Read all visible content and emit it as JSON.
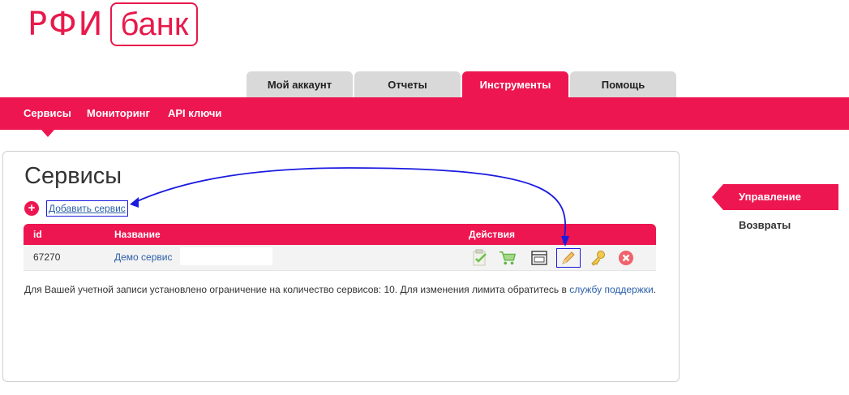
{
  "logo": {
    "left": "РФИ",
    "right": "банк"
  },
  "tabs": [
    {
      "label": "Мой аккаунт",
      "active": false
    },
    {
      "label": "Отчеты",
      "active": false
    },
    {
      "label": "Инструменты",
      "active": true
    },
    {
      "label": "Помощь",
      "active": false
    }
  ],
  "subnav": {
    "items": [
      "Сервисы",
      "Мониторинг",
      "API ключи"
    ],
    "active": "Сервисы"
  },
  "page": {
    "title": "Сервисы",
    "add_service": "Добавить сервис",
    "table": {
      "headers": {
        "id": "id",
        "name": "Название",
        "actions": "Действия"
      },
      "rows": [
        {
          "id": "67270",
          "name": "Демо сервис"
        }
      ],
      "action_icons": [
        "clipboard-check-icon",
        "cart-icon",
        "window-icon",
        "pencil-icon",
        "key-icon",
        "delete-icon"
      ]
    },
    "note": {
      "text": "Для Вашей учетной записи установлено ограничение на количество сервисов: 10. Для изменения лимита обратитесь в ",
      "link": "службу поддержки",
      "end": "."
    }
  },
  "sidebar": {
    "items": [
      "Управление",
      "Возвраты"
    ],
    "active": "Управление"
  },
  "colors": {
    "brand": "#ee1650",
    "link": "#2b5fa8",
    "annotation": "#1a1ae0"
  }
}
